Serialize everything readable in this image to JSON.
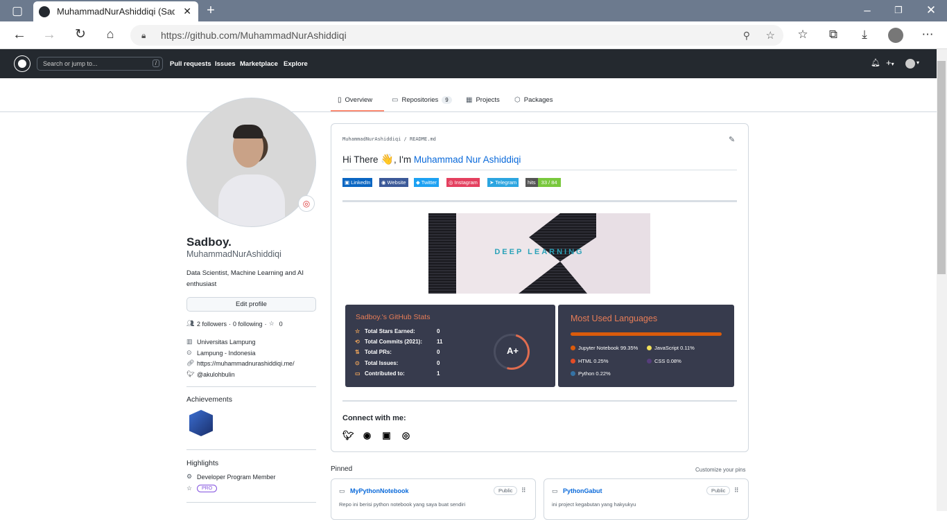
{
  "browser": {
    "tab_title": "MuhammadNurAshiddiqi (Sadboy.)",
    "url": "https://github.com/MuhammadNurAshiddiqi"
  },
  "gh_header": {
    "search_placeholder": "Search or jump to...",
    "search_key": "/",
    "nav": [
      "Pull requests",
      "Issues",
      "Marketplace",
      "Explore"
    ],
    "plus": "+",
    "caret": "▾"
  },
  "profile_tabs": [
    {
      "label": "Overview"
    },
    {
      "label": "Repositories",
      "count": "9"
    },
    {
      "label": "Projects"
    },
    {
      "label": "Packages"
    }
  ],
  "sidebar": {
    "name": "Sadboy.",
    "username": "MuhammadNurAshiddiqi",
    "bio": "Data Scientist, Machine Learning and AI enthusiast",
    "edit_button": "Edit profile",
    "followers": "2 followers",
    "following": "0 following",
    "stars": "0",
    "dot": "·",
    "org": "Universitas Lampung",
    "location": "Lampung - Indonesia",
    "website": "https://muhammadnurashiddiqi.me/",
    "twitter": "@akulohbulin",
    "achievements_title": "Achievements",
    "highlights_title": "Highlights",
    "highlight_member": "Developer Program Member",
    "highlight_pro": "PRO"
  },
  "readme": {
    "path_user": "MuhammadNurAshiddiqi",
    "path_sep": "/",
    "path_file": "README.md",
    "greeting": "Hi There",
    "wave": "👋",
    "im": ", I'm",
    "name": "Muhammad Nur Ashiddiqi",
    "shields": [
      {
        "label": "LinkedIn",
        "color": "#0a66c2"
      },
      {
        "label": "Website",
        "color": "#3b5998"
      },
      {
        "label": "Twitter",
        "color": "#1da1f2"
      },
      {
        "label": "Instagram",
        "color": "#e4405f"
      },
      {
        "label": "Telegram",
        "color": "#2ca5e0"
      }
    ],
    "hits_label": "hits",
    "hits_value": "33 / 84",
    "banner_text": "DEEP LEARNING",
    "connect": "Connect with me:"
  },
  "stats_card": {
    "title": "Sadboy.'s GitHub Stats",
    "rows": [
      {
        "label": "Total Stars Earned:",
        "value": "0"
      },
      {
        "label": "Total Commits (2021):",
        "value": "11"
      },
      {
        "label": "Total PRs:",
        "value": "0"
      },
      {
        "label": "Total Issues:",
        "value": "0"
      },
      {
        "label": "Contributed to:",
        "value": "1"
      }
    ],
    "grade": "A+"
  },
  "lang_card": {
    "title": "Most Used Languages",
    "langs": [
      {
        "name": "Jupyter Notebook 99.35%",
        "color": "#da5b0b"
      },
      {
        "name": "JavaScript 0.11%",
        "color": "#f1e05a"
      },
      {
        "name": "HTML 0.25%",
        "color": "#e34c26"
      },
      {
        "name": "CSS 0.08%",
        "color": "#563d7c"
      },
      {
        "name": "Python 0.22%",
        "color": "#3572a5"
      }
    ]
  },
  "pinned": {
    "title": "Pinned",
    "customize": "Customize your pins",
    "repos": [
      {
        "name": "MyPythonNotebook",
        "visibility": "Public",
        "desc": "Repo ini berisi python notebook yang saya buat sendiri"
      },
      {
        "name": "PythonGabut",
        "visibility": "Public",
        "desc": "ini project kegabutan yang hakyukyu"
      }
    ]
  }
}
